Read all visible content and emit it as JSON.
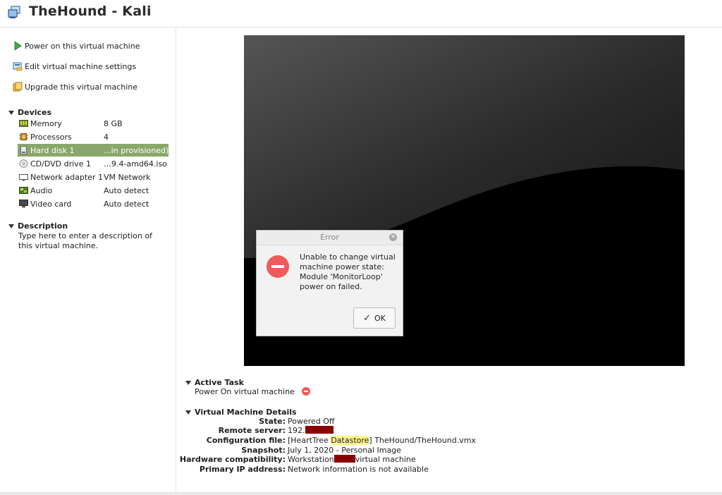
{
  "window": {
    "title": "TheHound - Kali"
  },
  "actions": [
    {
      "label": "Power on this virtual machine",
      "icon": "play-icon"
    },
    {
      "label": "Edit virtual machine settings",
      "icon": "settings-icon"
    },
    {
      "label": "Upgrade this virtual machine",
      "icon": "upgrade-icon"
    }
  ],
  "devices": {
    "header": "Devices",
    "items": [
      {
        "name": "Memory",
        "value": "8 GB",
        "icon": "memory-icon"
      },
      {
        "name": "Processors",
        "value": "4",
        "icon": "processor-icon"
      },
      {
        "name": "Hard disk 1",
        "value": "…in provisioned)",
        "icon": "hard-disk-icon",
        "selected": true
      },
      {
        "name": "CD/DVD drive 1",
        "value": "…9.4-amd64.iso",
        "icon": "cd-dvd-icon"
      },
      {
        "name": "Network adapter 1",
        "value": "VM Network",
        "icon": "network-adapter-icon"
      },
      {
        "name": "Audio",
        "value": "Auto detect",
        "icon": "audio-icon"
      },
      {
        "name": "Video card",
        "value": "Auto detect",
        "icon": "video-card-icon"
      }
    ]
  },
  "description": {
    "header": "Description",
    "placeholder": "Type here to enter a description of this virtual machine."
  },
  "error_dialog": {
    "title": "Error",
    "message": "Unable to change virtual machine power state: Module 'MonitorLoop' power on failed.",
    "ok_label": "OK",
    "close_glyph": "×"
  },
  "active_task": {
    "header": "Active Task",
    "task": "Power On virtual machine"
  },
  "details": {
    "header": "Virtual Machine Details",
    "state_label": "State:",
    "state_value": "Powered Off",
    "remote_label": "Remote server:",
    "remote_value": "192.",
    "config_label": "Configuration file:",
    "config_prefix": "[HeartTree ",
    "config_highlight": "Datastore",
    "config_suffix": "] TheHound/TheHound.vmx",
    "snapshot_label": "Snapshot:",
    "snapshot_value": "July 1, 2020 - Personal Image",
    "hw_label": "Hardware compatibility:",
    "hw_prefix": "Workstation",
    "hw_suffix": "virtual machine",
    "ip_label": "Primary IP address:",
    "ip_value": "Network information is not available"
  },
  "colors": {
    "selected_row": "#88a86b",
    "error_red": "#ee5b5b",
    "redaction": "#8b0000",
    "highlight": "#fff68a"
  }
}
